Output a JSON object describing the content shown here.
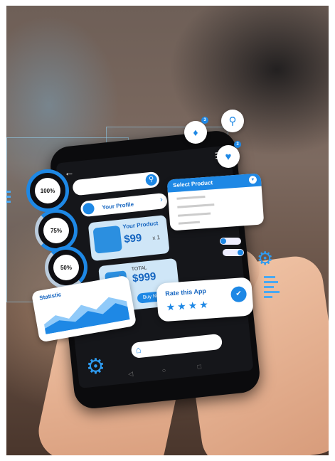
{
  "phone": {
    "profile_label": "Your Profile",
    "product_title": "Your Product",
    "product_price": "$99",
    "product_qty": "x 1",
    "total_label": "TOTAL",
    "total_price": "$999",
    "buy_label": "Buy Now"
  },
  "overlays": {
    "rings": [
      "100%",
      "75%",
      "50%"
    ],
    "ring_levels": [
      1.0,
      0.75,
      0.5
    ],
    "select_title": "Select Product",
    "select_options": [
      "",
      "",
      "",
      ""
    ],
    "rate_title": "Rate this App",
    "rating_stars": 4,
    "chart_title": "Statistic",
    "accent_color": "#1e88e5",
    "icons": [
      "bell-icon",
      "search-icon",
      "heart-icon",
      "gear-icon",
      "home-icon",
      "user-icon",
      "arrow-left-icon",
      "menu-icon"
    ]
  }
}
